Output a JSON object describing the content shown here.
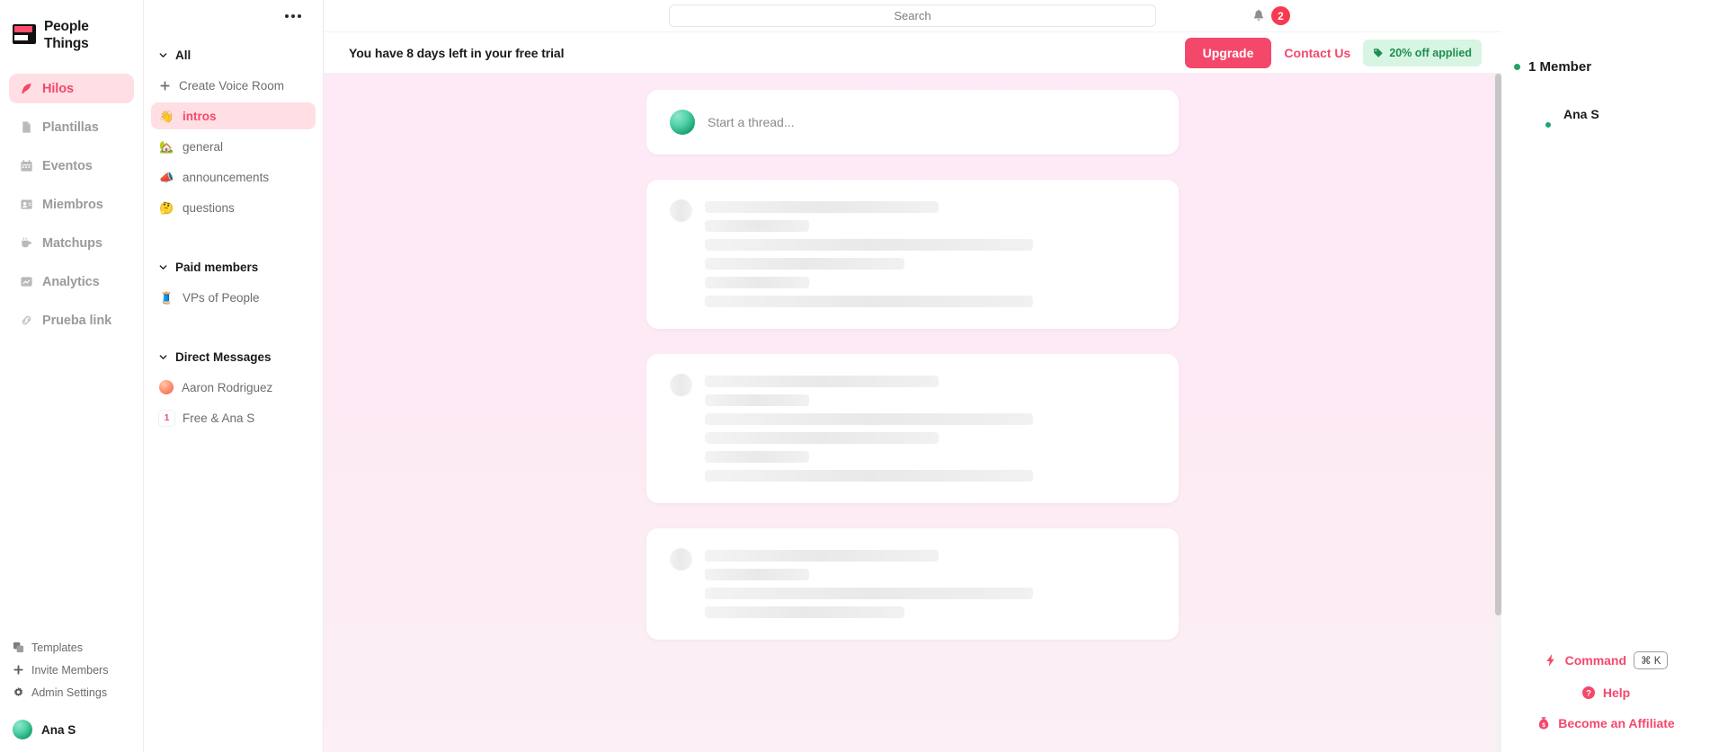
{
  "brand": {
    "name": "People\nThings",
    "logo_icon": "people-things-logo"
  },
  "rail": {
    "items": [
      {
        "label": "Hilos",
        "icon": "feather-icon",
        "active": true
      },
      {
        "label": "Plantillas",
        "icon": "document-icon",
        "active": false
      },
      {
        "label": "Eventos",
        "icon": "calendar-icon",
        "active": false
      },
      {
        "label": "Miembros",
        "icon": "contact-card-icon",
        "active": false
      },
      {
        "label": "Matchups",
        "icon": "coffee-cup-icon",
        "active": false
      },
      {
        "label": "Analytics",
        "icon": "chart-image-icon",
        "active": false
      },
      {
        "label": "Prueba link",
        "icon": "link-icon",
        "active": false
      }
    ],
    "bottom_items": [
      {
        "label": "Templates",
        "icon": "templates-icon"
      },
      {
        "label": "Invite Members",
        "icon": "plus-icon"
      },
      {
        "label": "Admin Settings",
        "icon": "gear-icon"
      }
    ],
    "user": {
      "name": "Ana S",
      "avatar": "user-avatar-green"
    }
  },
  "channels": {
    "more_icon": "ellipsis-icon",
    "groups": [
      {
        "title": "All",
        "chevron_icon": "chevron-down-icon",
        "items": [
          {
            "label": "Create Voice Room",
            "icon": "plus-icon",
            "type": "action",
            "active": false
          },
          {
            "label": "intros",
            "emoji": "👋",
            "type": "channel",
            "active": true
          },
          {
            "label": "general",
            "emoji": "🏡",
            "type": "channel",
            "active": false
          },
          {
            "label": "announcements",
            "emoji": "📣",
            "type": "channel",
            "active": false
          },
          {
            "label": "questions",
            "emoji": "🤔",
            "type": "channel",
            "active": false
          }
        ]
      },
      {
        "title": "Paid members",
        "chevron_icon": "chevron-down-icon",
        "items": [
          {
            "label": "VPs of People",
            "emoji": "🧵",
            "type": "channel",
            "active": false
          }
        ]
      },
      {
        "title": "Direct Messages",
        "chevron_icon": "chevron-down-icon",
        "items": [
          {
            "label": "Aaron Rodriguez",
            "type": "dm-avatar",
            "active": false
          },
          {
            "label": "Free & Ana S",
            "type": "dm-badge",
            "badge": "1",
            "active": false
          }
        ]
      }
    ]
  },
  "topbar": {
    "search_placeholder": "Search",
    "search_value": "",
    "bell_icon": "bell-icon",
    "notification_count": "2"
  },
  "trial": {
    "message": "You have 8 days left in your free trial",
    "upgrade_label": "Upgrade",
    "contact_label": "Contact Us",
    "discount_label": "20% off applied",
    "discount_icon": "tag-icon"
  },
  "feed": {
    "composer_placeholder": "Start a thread...",
    "composer_avatar": "user-avatar-green",
    "skeleton_cards": [
      {
        "lines": [
          260,
          116,
          365,
          222,
          116,
          365
        ]
      },
      {
        "lines": [
          260,
          116,
          365,
          260,
          116,
          365
        ]
      },
      {
        "lines": [
          260,
          116,
          365,
          222
        ]
      }
    ]
  },
  "right": {
    "member_count_label": "1 Member",
    "members": [
      {
        "name": "Ana S",
        "avatar": "user-avatar-green",
        "status": "online"
      }
    ],
    "command_label": "Command",
    "command_shortcut": "⌘ K",
    "command_icon": "bolt-icon",
    "help_label": "Help",
    "help_icon": "question-circle-icon",
    "affiliate_label": "Become an Affiliate",
    "affiliate_icon": "money-bag-icon"
  },
  "colors": {
    "accent": "#f4486b",
    "accent_soft": "#ffdfe4",
    "badge_red": "#f8394f",
    "green": "#1e8e52",
    "green_soft": "#d8f5e3",
    "feed_bg": "#fdeaf6"
  }
}
